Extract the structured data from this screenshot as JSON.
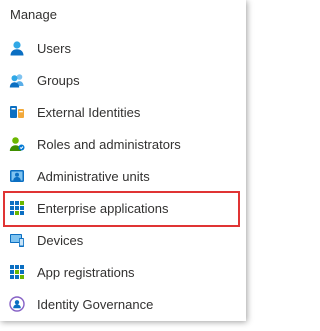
{
  "section": {
    "title": "Manage"
  },
  "nav": {
    "items": [
      {
        "label": "Users",
        "icon": "user-icon"
      },
      {
        "label": "Groups",
        "icon": "group-icon"
      },
      {
        "label": "External Identities",
        "icon": "external-identities-icon"
      },
      {
        "label": "Roles and administrators",
        "icon": "roles-admin-icon"
      },
      {
        "label": "Administrative units",
        "icon": "admin-units-icon"
      },
      {
        "label": "Enterprise applications",
        "icon": "enterprise-apps-icon"
      },
      {
        "label": "Devices",
        "icon": "devices-icon"
      },
      {
        "label": "App registrations",
        "icon": "app-registrations-icon"
      },
      {
        "label": "Identity Governance",
        "icon": "identity-governance-icon"
      }
    ]
  },
  "highlight": {
    "item": "Enterprise applications",
    "color": "#e03434"
  },
  "colors": {
    "accent": "#0078d4",
    "text": "#323130",
    "green": "#6bb700"
  }
}
